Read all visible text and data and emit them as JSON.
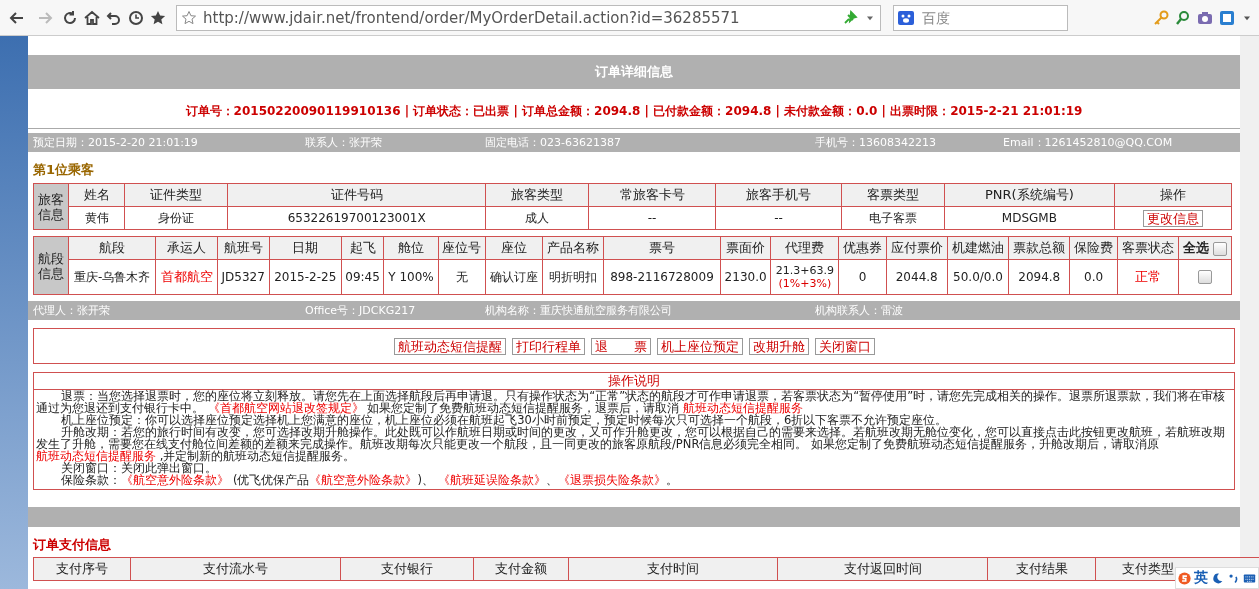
{
  "browser": {
    "url": "http://www.jdair.net/frontend/order/MyOrderDetail.action?id=36285571",
    "search_placeholder": "百度",
    "back_disabled": false,
    "forward_disabled": true
  },
  "page_title": "订单详细信息",
  "summary": "订单号：20150220090119910136 | 订单状态：已出票 | 订单总金额：2094.8 | 已付款金额：2094.8 | 未付款金额：0.0 | 出票时限：2015-2-21 21:01:19",
  "order_info": [
    "预定日期：2015-2-20 21:01:19",
    "联系人：张开荣",
    "固定电话：023-63621387",
    "手机号：13608342213",
    "Email：1261452810@QQ.COM"
  ],
  "passenger_heading": "第1位乘客",
  "passenger_table": {
    "label": "旅客信息",
    "columns": [
      "姓名",
      "证件类型",
      "证件号码",
      "旅客类型",
      "常旅客卡号",
      "旅客手机号",
      "客票类型",
      "PNR(系统编号)",
      "操作"
    ],
    "cells": [
      "黄伟",
      "身份证",
      "65322619700123001X",
      "成人",
      "--",
      "--",
      "电子客票",
      "MDSGMB"
    ],
    "action": "更改信息"
  },
  "flight_table": {
    "label": "航段信息",
    "columns": [
      {
        "text": "航段",
        "kind": "text"
      },
      {
        "text": "承运人",
        "kind": "text"
      },
      {
        "text": "航班号",
        "kind": "text"
      },
      {
        "text": "日期",
        "kind": "text"
      },
      {
        "text": "起飞",
        "kind": "text"
      },
      {
        "text": "舱位",
        "kind": "text"
      },
      {
        "text": "座位号",
        "kind": "text"
      },
      {
        "text": "座位",
        "kind": "text"
      },
      {
        "text": "产品名称",
        "kind": "text"
      },
      {
        "text": "票号",
        "kind": "text"
      },
      {
        "text": "票面价",
        "kind": "text"
      },
      {
        "text": "代理费",
        "kind": "text"
      },
      {
        "text": "优惠券",
        "kind": "text"
      },
      {
        "text": "应付票价",
        "kind": "text"
      },
      {
        "text": "机建燃油",
        "kind": "text"
      },
      {
        "text": "票款总额",
        "kind": "text"
      },
      {
        "text": "保险费",
        "kind": "text"
      },
      {
        "text": "客票状态",
        "kind": "text"
      },
      {
        "text": "全选",
        "kind": "checkbox",
        "checked": false
      }
    ],
    "cells": [
      {
        "kind": "text",
        "text": "重庆-乌鲁木齐"
      },
      {
        "kind": "alert",
        "text": "首都航空"
      },
      {
        "kind": "text",
        "text": "JD5327"
      },
      {
        "kind": "text",
        "text": "2015-2-25"
      },
      {
        "kind": "text",
        "text": "09:45"
      },
      {
        "kind": "text",
        "text": "Y 100%"
      },
      {
        "kind": "text",
        "text": "无"
      },
      {
        "kind": "text",
        "text": "确认订座"
      },
      {
        "kind": "text",
        "text": "明折明扣"
      },
      {
        "kind": "text",
        "text": "898-2116728009"
      },
      {
        "kind": "text",
        "text": "2130.0"
      },
      {
        "kind": "fee",
        "text": "21.3+63.9",
        "note": "(1%+3%)"
      },
      {
        "kind": "text",
        "text": "0"
      },
      {
        "kind": "text",
        "text": "2044.8"
      },
      {
        "kind": "text",
        "text": "50.0/0.0"
      },
      {
        "kind": "text",
        "text": "2094.8"
      },
      {
        "kind": "text",
        "text": "0.0"
      },
      {
        "kind": "alert",
        "text": "正常"
      },
      {
        "kind": "checkbox",
        "checked": false
      }
    ]
  },
  "agent_info": [
    "代理人：张开荣",
    "Office号：JDCKG217",
    "机构名称：重庆快通航空服务有限公司",
    "机构联系人：雷波"
  ],
  "actions": [
    "航班动态短信提醒",
    "打印行程单",
    "退　　票",
    "机上座位预定",
    "改期升舱",
    "关闭窗口"
  ],
  "instructions": {
    "title": "操作说明",
    "paragraphs": [
      [
        {
          "kind": "plain",
          "text": "退票：当您选择退票时，您的座位将立刻释放。请您先在上面选择航段后再申请退。只有操作状态为“正常”状态的航段才可作申请退票，若客票状态为“暂停使用”时，请您先完成相关的操作。退票所退票款，我们将在审核通过为您退还到支付银行卡中。 "
        },
        {
          "kind": "link",
          "text": "《首都航空网站退改签规定》"
        },
        {
          "kind": "plain",
          "text": " 如果您定制了免费航班动态短信提醒服务，退票后，请取消 "
        },
        {
          "kind": "link",
          "text": "航班动态短信提醒服务"
        }
      ],
      [
        {
          "kind": "plain",
          "text": "机上座位预定：你可以选择座位预定选择机上您满意的座位，机上座位必须在航班起飞30小时前预定，预定时候每次只可选择一个航段，6折以下客票不允许预定座位。"
        }
      ],
      [
        {
          "kind": "plain",
          "text": "升舱改期：若您的旅行时间有改变，您可选择改期升舱操作。此处既可以作航班日期或时间的更改，又可作升舱更改，您可以根据自己的需要来选择。若航班改期无舱位变化，您可以直接点击此按钮更改航班，若航班改期发生了升舱，需要您在线支付舱位间差额的差额来完成操作。航班改期每次只能更改一个航段，且一同更改的旅客原航段/PNR信息必须完全相同。 如果您定制了免费航班动态短信提醒服务，升舱改期后，请取消原 "
        },
        {
          "kind": "link",
          "text": "航班动态短信提醒服务"
        },
        {
          "kind": "plain",
          "text": " ,并定制新的航班动态短信提醒服务。"
        }
      ],
      [
        {
          "kind": "plain",
          "text": "关闭窗口：关闭此弹出窗口。"
        }
      ],
      [
        {
          "kind": "plain",
          "text": "保险条款："
        },
        {
          "kind": "link",
          "text": "《航空意外险条款》"
        },
        {
          "kind": "plain",
          "text": " (优飞优保产品"
        },
        {
          "kind": "link",
          "text": "《航空意外险条款》"
        },
        {
          "kind": "plain",
          "text": ")、 "
        },
        {
          "kind": "link",
          "text": "《航班延误险条款》"
        },
        {
          "kind": "plain",
          "text": "、"
        },
        {
          "kind": "link",
          "text": "《退票损失险条款》"
        },
        {
          "kind": "plain",
          "text": "。"
        }
      ]
    ]
  },
  "payment_heading": "订单支付信息",
  "payment_columns": [
    "支付序号",
    "支付流水号",
    "支付银行",
    "支付金额",
    "支付时间",
    "支付返回时间",
    "支付结果",
    "支付类型"
  ],
  "ime_bar": {
    "mode": "英"
  }
}
